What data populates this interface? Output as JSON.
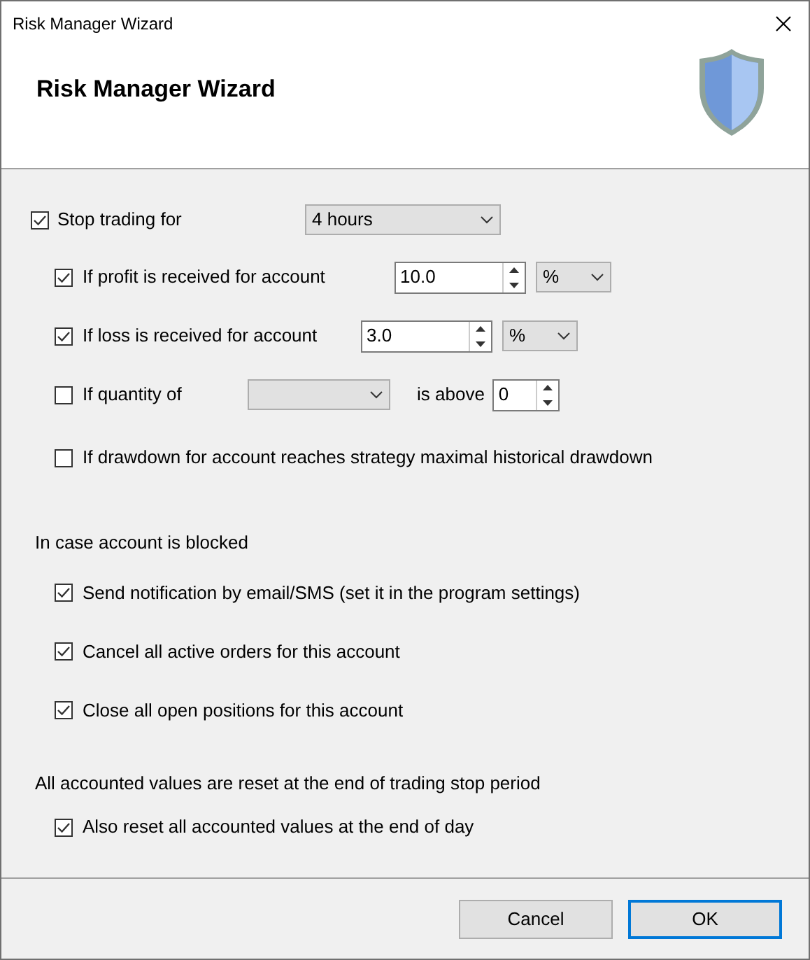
{
  "window": {
    "title": "Risk Manager Wizard"
  },
  "header": {
    "title": "Risk Manager Wizard"
  },
  "stop_trading": {
    "label": "Stop trading for",
    "checked": true,
    "period": "4 hours"
  },
  "conditions": [
    {
      "kind": "value",
      "label": "If profit is received for account",
      "checked": true,
      "value": "10.0",
      "unit": "%"
    },
    {
      "kind": "value",
      "label": "If loss is received for account",
      "checked": true,
      "value": "3.0",
      "unit": "%"
    },
    {
      "kind": "quantity",
      "label": "If quantity of",
      "checked": false,
      "after_label": "is above",
      "value": "0"
    },
    {
      "kind": "plain",
      "label": "If drawdown for account reaches strategy maximal historical drawdown",
      "checked": false
    }
  ],
  "blocked_section": {
    "heading": "In case account is blocked",
    "options": [
      {
        "label": "Send notification by email/SMS (set it in the program settings)",
        "checked": true
      },
      {
        "label": "Cancel all active orders for this account",
        "checked": true
      },
      {
        "label": "Close all open positions for this account",
        "checked": true
      }
    ]
  },
  "reset_section": {
    "heading": "All accounted values are reset at the end of trading stop period",
    "options": [
      {
        "label": "Also reset all accounted values at the end of day",
        "checked": true
      }
    ]
  },
  "buttons": [
    {
      "label": "Cancel",
      "default": false
    },
    {
      "label": "OK",
      "default": true
    }
  ]
}
